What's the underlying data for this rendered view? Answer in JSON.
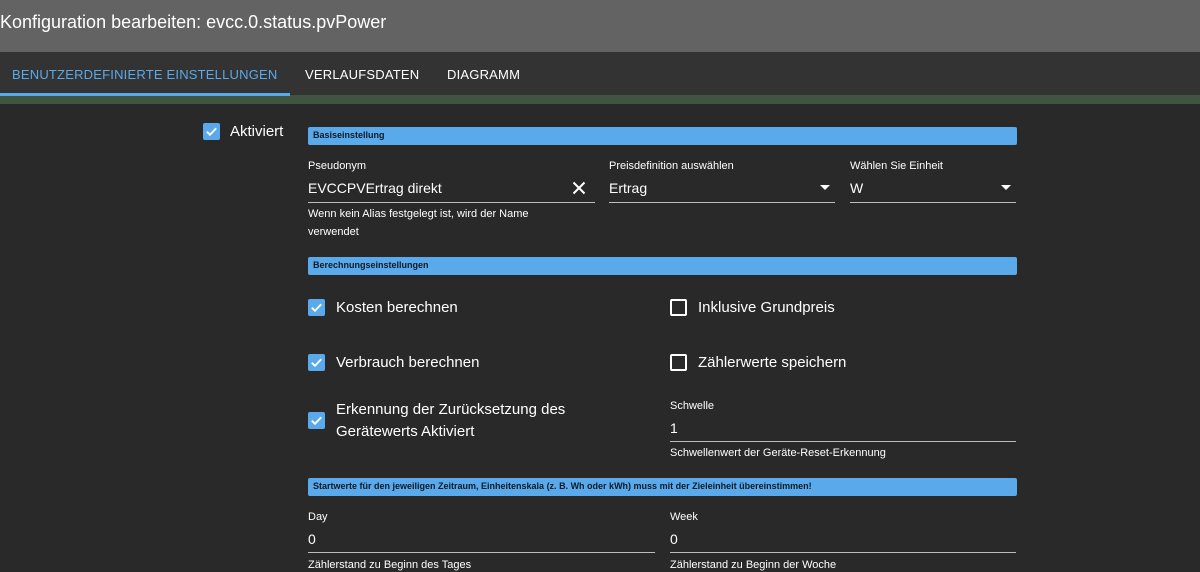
{
  "dialog": {
    "title": "Konfiguration bearbeiten: evcc.0.status.pvPower"
  },
  "tabs": [
    {
      "label": "BENUTZERDEFINIERTE EINSTELLUNGEN",
      "active": true
    },
    {
      "label": "VERLAUFSDATEN",
      "active": false
    },
    {
      "label": "DIAGRAMM",
      "active": false
    }
  ],
  "enabled": {
    "label": "Aktiviert",
    "checked": true
  },
  "basic": {
    "header": "Basiseinstellung",
    "alias": {
      "label": "Pseudonym",
      "value": "EVCCPVErtrag direkt",
      "helper": "Wenn kein Alias festgelegt ist, wird der Name verwendet"
    },
    "price": {
      "label": "Preisdefinition auswählen",
      "value": "Ertrag"
    },
    "unit": {
      "label": "Wählen Sie Einheit",
      "value": "W"
    }
  },
  "calc": {
    "header": "Berechnungseinstellungen",
    "costs": {
      "label": "Kosten berechnen",
      "checked": true
    },
    "basePrice": {
      "label": "Inklusive Grundpreis",
      "checked": false
    },
    "consumption": {
      "label": "Verbrauch berechnen",
      "checked": true
    },
    "meterValues": {
      "label": "Zählerwerte speichern",
      "checked": false
    },
    "reset": {
      "label": "Erkennung der Zurücksetzung des Gerätewerts Aktiviert",
      "checked": true
    },
    "threshold": {
      "label": "Schwelle",
      "value": "1",
      "helper": "Schwellenwert der Geräte-Reset-Erkennung"
    }
  },
  "start": {
    "header": "Startwerte für den jeweiligen Zeitraum, Einheitenskala (z. B. Wh oder kWh) muss mit der Zieleinheit übereinstimmen!",
    "day": {
      "label": "Day",
      "value": "0",
      "helper": "Zählerstand zu Beginn des Tages"
    },
    "week": {
      "label": "Week",
      "value": "0",
      "helper": "Zählerstand zu Beginn der Woche"
    }
  },
  "colors": {
    "accent": "#5aa9ea",
    "background": "#292929",
    "titlebar": "#636363",
    "tabbar": "#333333"
  }
}
